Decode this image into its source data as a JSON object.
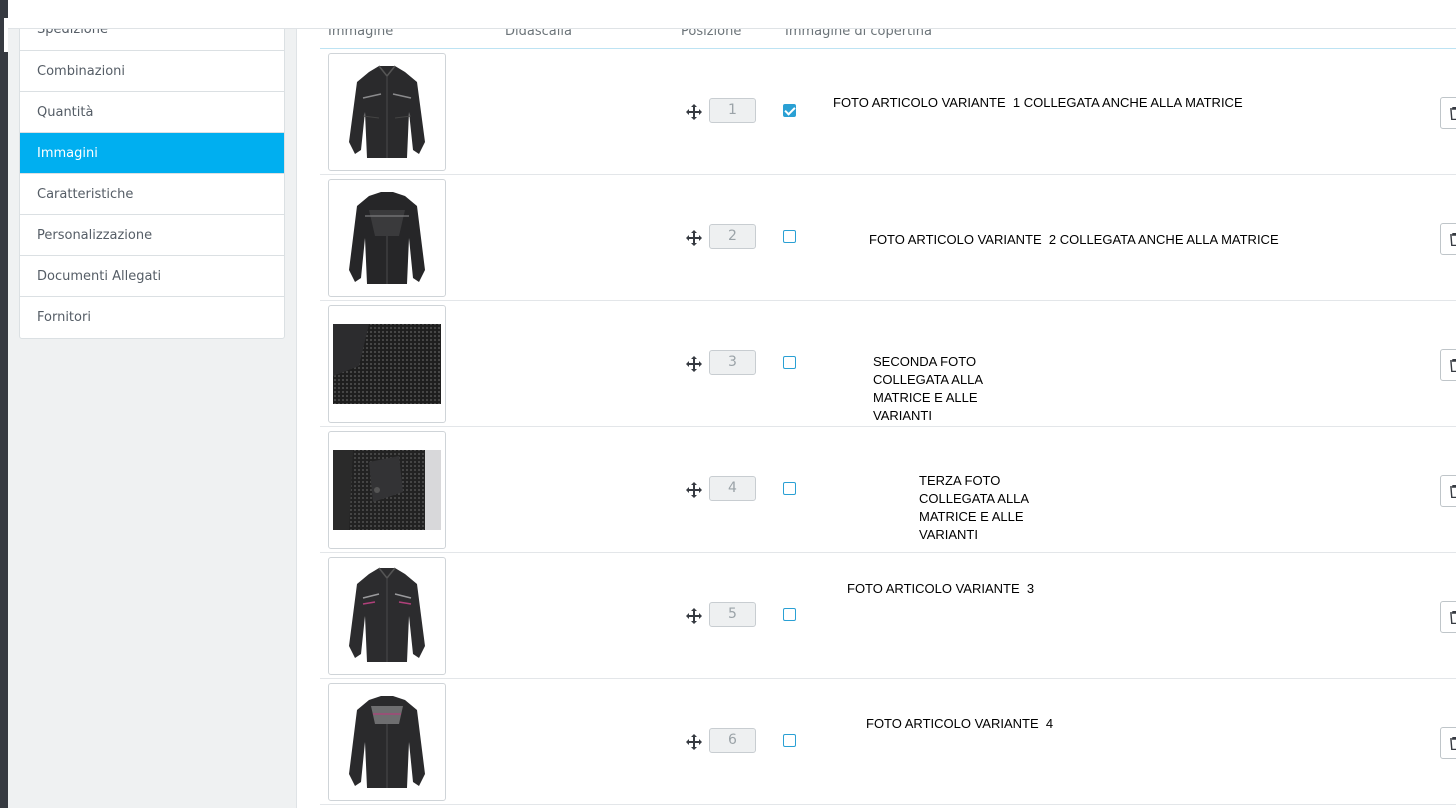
{
  "sidebar": {
    "items": [
      {
        "label": "Spedizione",
        "active": false
      },
      {
        "label": "Combinazioni",
        "active": false
      },
      {
        "label": "Quantità",
        "active": false
      },
      {
        "label": "Immagini",
        "active": true
      },
      {
        "label": "Caratteristiche",
        "active": false
      },
      {
        "label": "Personalizzazione",
        "active": false
      },
      {
        "label": "Documenti Allegati",
        "active": false
      },
      {
        "label": "Fornitori",
        "active": false
      }
    ]
  },
  "table": {
    "headers": {
      "image": "Immagine",
      "caption": "Didascalia",
      "position": "Posizione",
      "cover": "Immagine di copertina"
    },
    "rows": [
      {
        "position": "1",
        "cover": true,
        "thumb": "jacket-front",
        "note": "FOTO ARTICOLO VARIANTE  1 COLLEGATA ANCHE ALLA MATRICE"
      },
      {
        "position": "2",
        "cover": false,
        "thumb": "jacket-back",
        "note": "FOTO ARTICOLO VARIANTE  2 COLLEGATA ANCHE ALLA MATRICE"
      },
      {
        "position": "3",
        "cover": false,
        "thumb": "mesh-detail",
        "note": "SECONDA FOTO\nCOLLEGATA ALLA\nMATRICE E ALLE\nVARIANTI"
      },
      {
        "position": "4",
        "cover": false,
        "thumb": "shoulder-detail",
        "note": "TERZA FOTO\nCOLLEGATA ALLA\nMATRICE E ALLE\nVARIANTI"
      },
      {
        "position": "5",
        "cover": false,
        "thumb": "jacket-front-pink",
        "note": "FOTO ARTICOLO VARIANTE  3"
      },
      {
        "position": "6",
        "cover": false,
        "thumb": "jacket-back-pink",
        "note": "FOTO ARTICOLO VARIANTE  4"
      }
    ]
  },
  "icons": {
    "drag": "move-arrows-icon",
    "delete": "trash-icon",
    "check": "checkbox-icon"
  },
  "colors": {
    "accent": "#00aff0",
    "checkbox": "#2aa0d4"
  }
}
